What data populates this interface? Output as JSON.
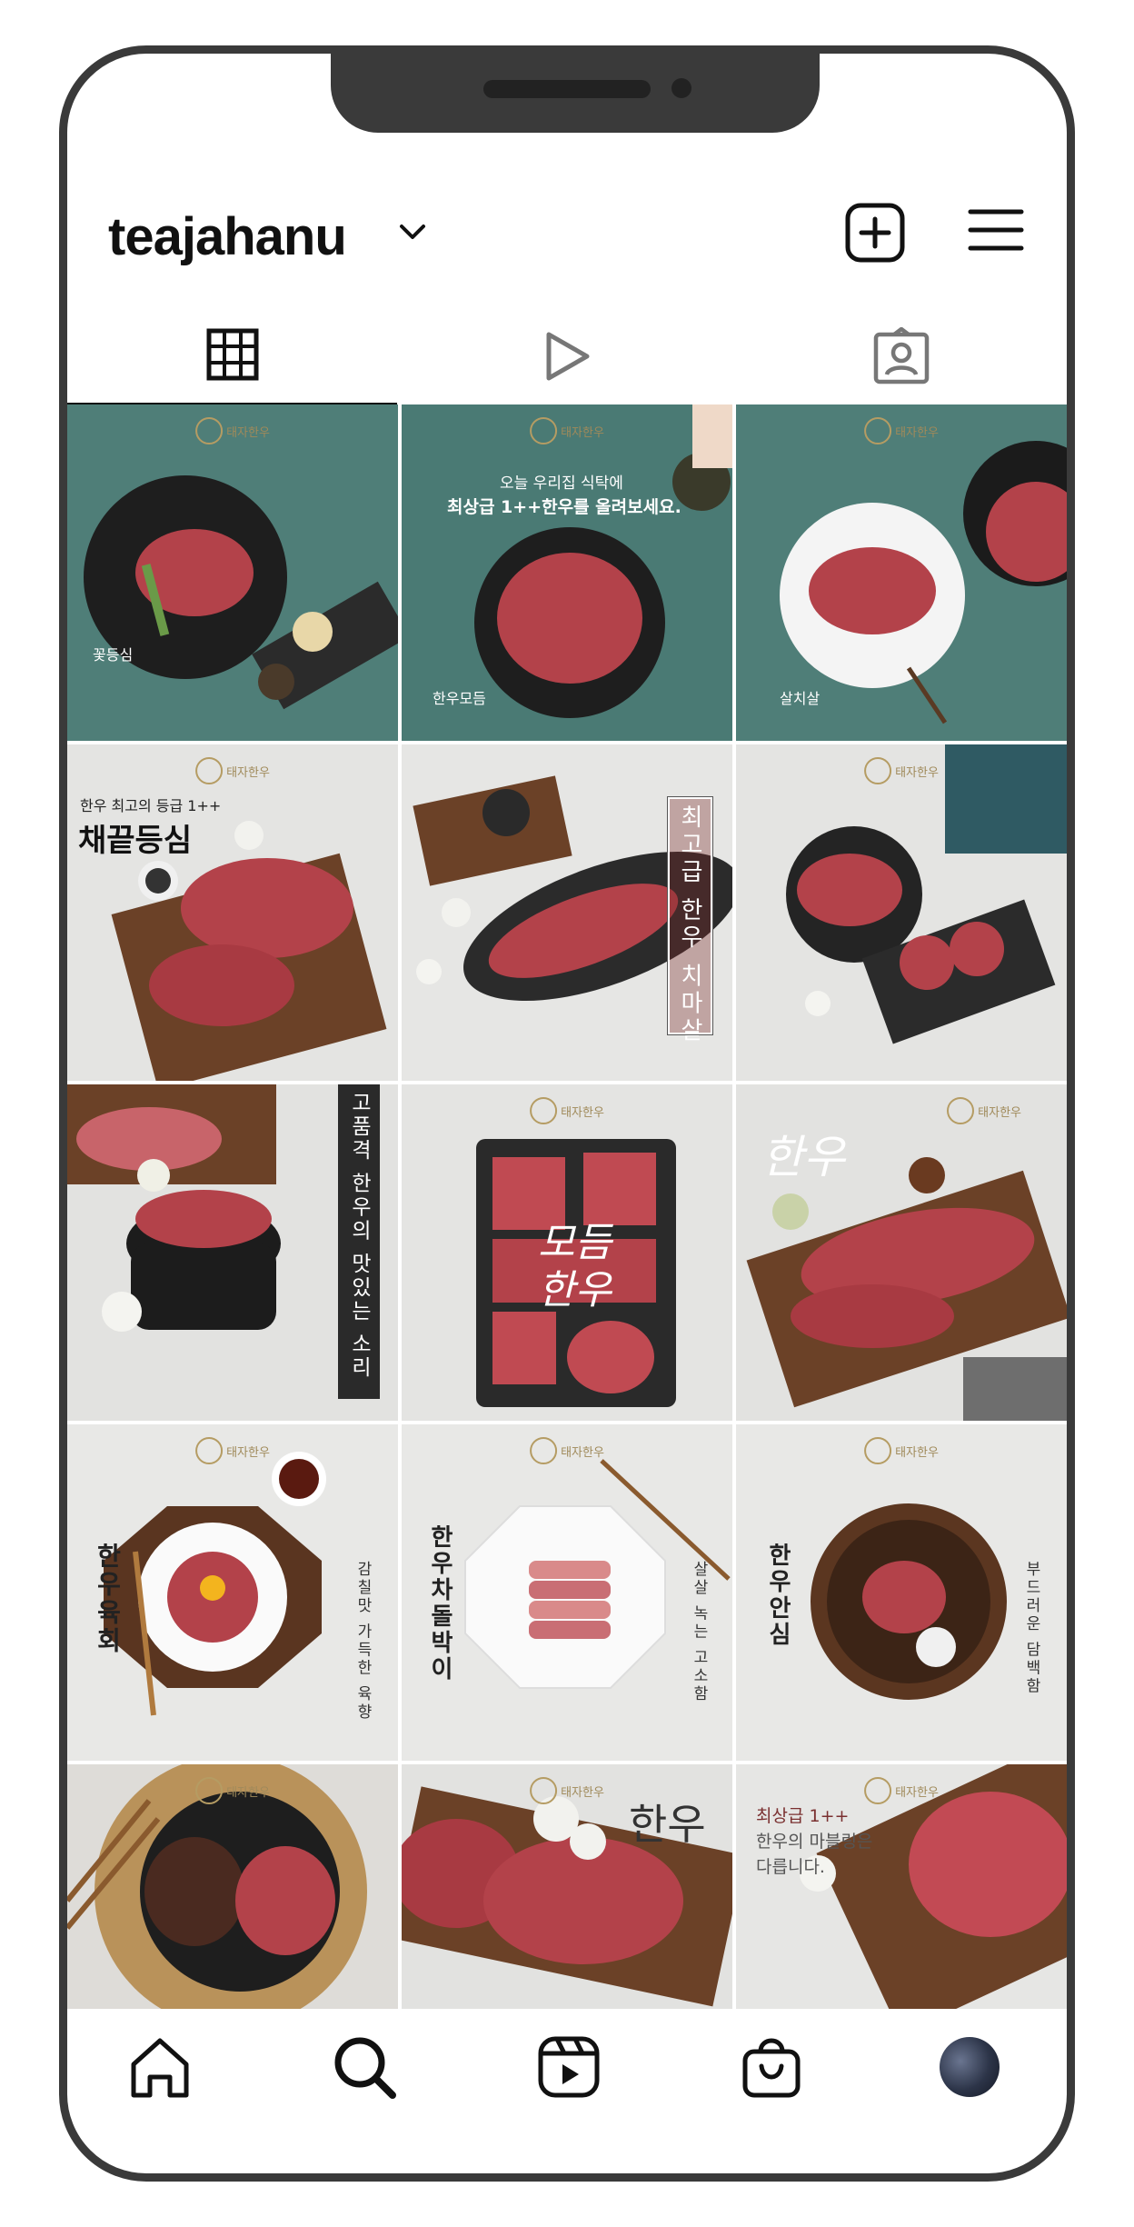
{
  "profile": {
    "username": "teajahanu"
  },
  "header_icons": [
    "chevron-down-icon",
    "add-post-icon",
    "menu-icon"
  ],
  "tabs": [
    {
      "name": "grid",
      "icon": "grid-icon",
      "active": true
    },
    {
      "name": "reels",
      "icon": "play-icon",
      "active": false
    },
    {
      "name": "tagged",
      "icon": "tagged-user-icon",
      "active": false
    }
  ],
  "colors": {
    "teal_bg": "#4f7e78",
    "grey_bg": "#dcdcdc",
    "meat": "#b3424a",
    "dark_board": "#2b2b2b",
    "wood": "#6b4127",
    "gold": "#a08a5a"
  },
  "posts": [
    {
      "brand": "태자한우",
      "label": "꽃등심"
    },
    {
      "brand": "태자한우",
      "line1": "오늘 우리집 식탁에",
      "line2": "최상급 1++한우를 올려보세요.",
      "label": "한우모듬"
    },
    {
      "brand": "태자한우",
      "label": "살치살"
    },
    {
      "brand": "태자한우",
      "line1": "한우 최고의 등급 1++",
      "title": "채끝등심"
    },
    {
      "vertical": "최고급 한우 치마살"
    },
    {
      "brand": "태자한우"
    },
    {
      "vertical": "고품격 한우의 맛있는 소리"
    },
    {
      "brand": "태자한우",
      "overlay1": "모듬",
      "overlay2": "한우"
    },
    {
      "brand": "태자한우",
      "overlay1": "한우"
    },
    {
      "brand": "태자한우",
      "title_v": "한우육회",
      "sub_v": "감칠맛 가득한 육향"
    },
    {
      "brand": "태자한우",
      "title_v": "한우차돌박이",
      "sub_v": "살살 녹는 고소함"
    },
    {
      "brand": "태자한우",
      "title_v": "한우안심",
      "sub_v": "부드러운 담백함"
    },
    {
      "brand": "태자한우"
    },
    {
      "brand": "태자한우",
      "overlay1": "한우"
    },
    {
      "brand": "태자한우",
      "line1": "최상급 1++",
      "line2": "한우의 마블링은",
      "line3": "다릅니다."
    }
  ],
  "bottom_nav": [
    "home-icon",
    "search-icon",
    "reels-icon",
    "shop-icon",
    "profile-avatar"
  ]
}
